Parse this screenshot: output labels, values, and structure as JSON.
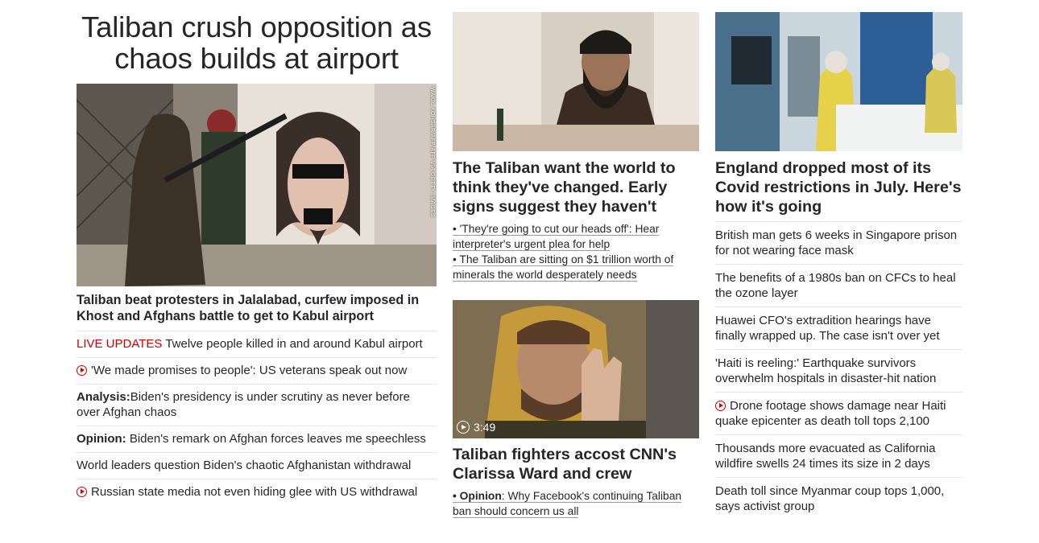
{
  "left": {
    "headline": "Taliban crush opposition as chaos builds at airport",
    "photo_credit": "WAKIL KOHSAR/AFP/AFP VIA GETTY IMAGES",
    "lead": "Taliban beat protesters in Jalalabad, curfew imposed in Khost and Afghans battle to get to Kabul airport",
    "items": [
      {
        "prefix": "LIVE UPDATES",
        "text": "Twelve people killed in and around Kabul airport"
      },
      {
        "icon": "play-icon",
        "text": "'We made promises to people': US veterans speak out now"
      },
      {
        "prefix": "Analysis:",
        "text": "Biden's presidency is under scrutiny as never before over Afghan chaos"
      },
      {
        "prefix": "Opinion:",
        "text": "Biden's remark on Afghan forces leaves me speechless"
      },
      {
        "text": "World leaders question Biden's chaotic Afghanistan withdrawal"
      },
      {
        "icon": "play-icon",
        "text": "Russian state media not even hiding glee with US withdrawal"
      }
    ]
  },
  "middle": {
    "card1": {
      "title": "The Taliban want the world to think they've changed. Early signs suggest they haven't",
      "links": [
        "• 'They're going to cut our heads off': Hear interpreter's urgent plea for help",
        "• The Taliban are sitting on $1 trillion worth of minerals the world desperately needs"
      ]
    },
    "card2": {
      "video_duration": "3:49",
      "title": "Taliban fighters accost CNN's Clarissa Ward and crew",
      "link_prefix": "• Opinion",
      "link_text": ": Why Facebook's continuing Taliban ban should concern us all"
    }
  },
  "right": {
    "title": "England dropped most of its Covid restrictions in July. Here's how it's going",
    "items": [
      {
        "text": "British man gets 6 weeks in Singapore prison for not wearing face mask"
      },
      {
        "text": "The benefits of a 1980s ban on CFCs to heal the ozone layer"
      },
      {
        "text": "Huawei CFO's extradition hearings have finally wrapped up. The case isn't over yet"
      },
      {
        "text": "'Haiti is reeling:' Earthquake survivors overwhelm hospitals in disaster-hit nation"
      },
      {
        "icon": "play-icon",
        "text": "Drone footage shows damage near Haiti quake epicenter as death toll tops 2,100"
      },
      {
        "text": "Thousands more evacuated as California wildfire swells 24 times its size in 2 days"
      },
      {
        "text": "Death toll since Myanmar coup tops 1,000, says activist group"
      }
    ]
  },
  "colors": {
    "accent_red": "#cc0000",
    "text": "#262626",
    "divider": "#e6e6e6"
  }
}
